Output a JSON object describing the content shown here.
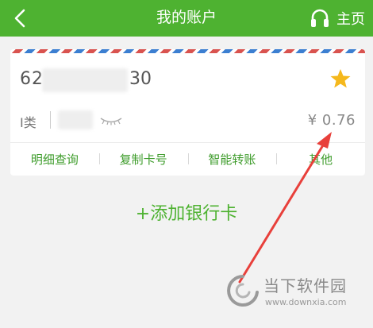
{
  "header": {
    "title": "我的账户",
    "home_label": "主页",
    "back_icon": "chevron-left-icon",
    "home_icon": "headphones-icon",
    "bg_color": "#4eb231"
  },
  "card": {
    "number_start": "62",
    "number_end": "30",
    "type_label": "I类",
    "balance": "¥ 0.76",
    "favorite_icon": "star-icon",
    "star_color": "#f5b81c",
    "visibility_icon": "eye-closed-icon",
    "actions": [
      {
        "label": "明细查询"
      },
      {
        "label": "复制卡号"
      },
      {
        "label": "智能转账"
      },
      {
        "label": "其他"
      }
    ]
  },
  "add_card_label": "+添加银行卡",
  "accent_color": "#4eb231",
  "watermark": {
    "name": "当下软件园",
    "url": "www.downxia.com"
  }
}
